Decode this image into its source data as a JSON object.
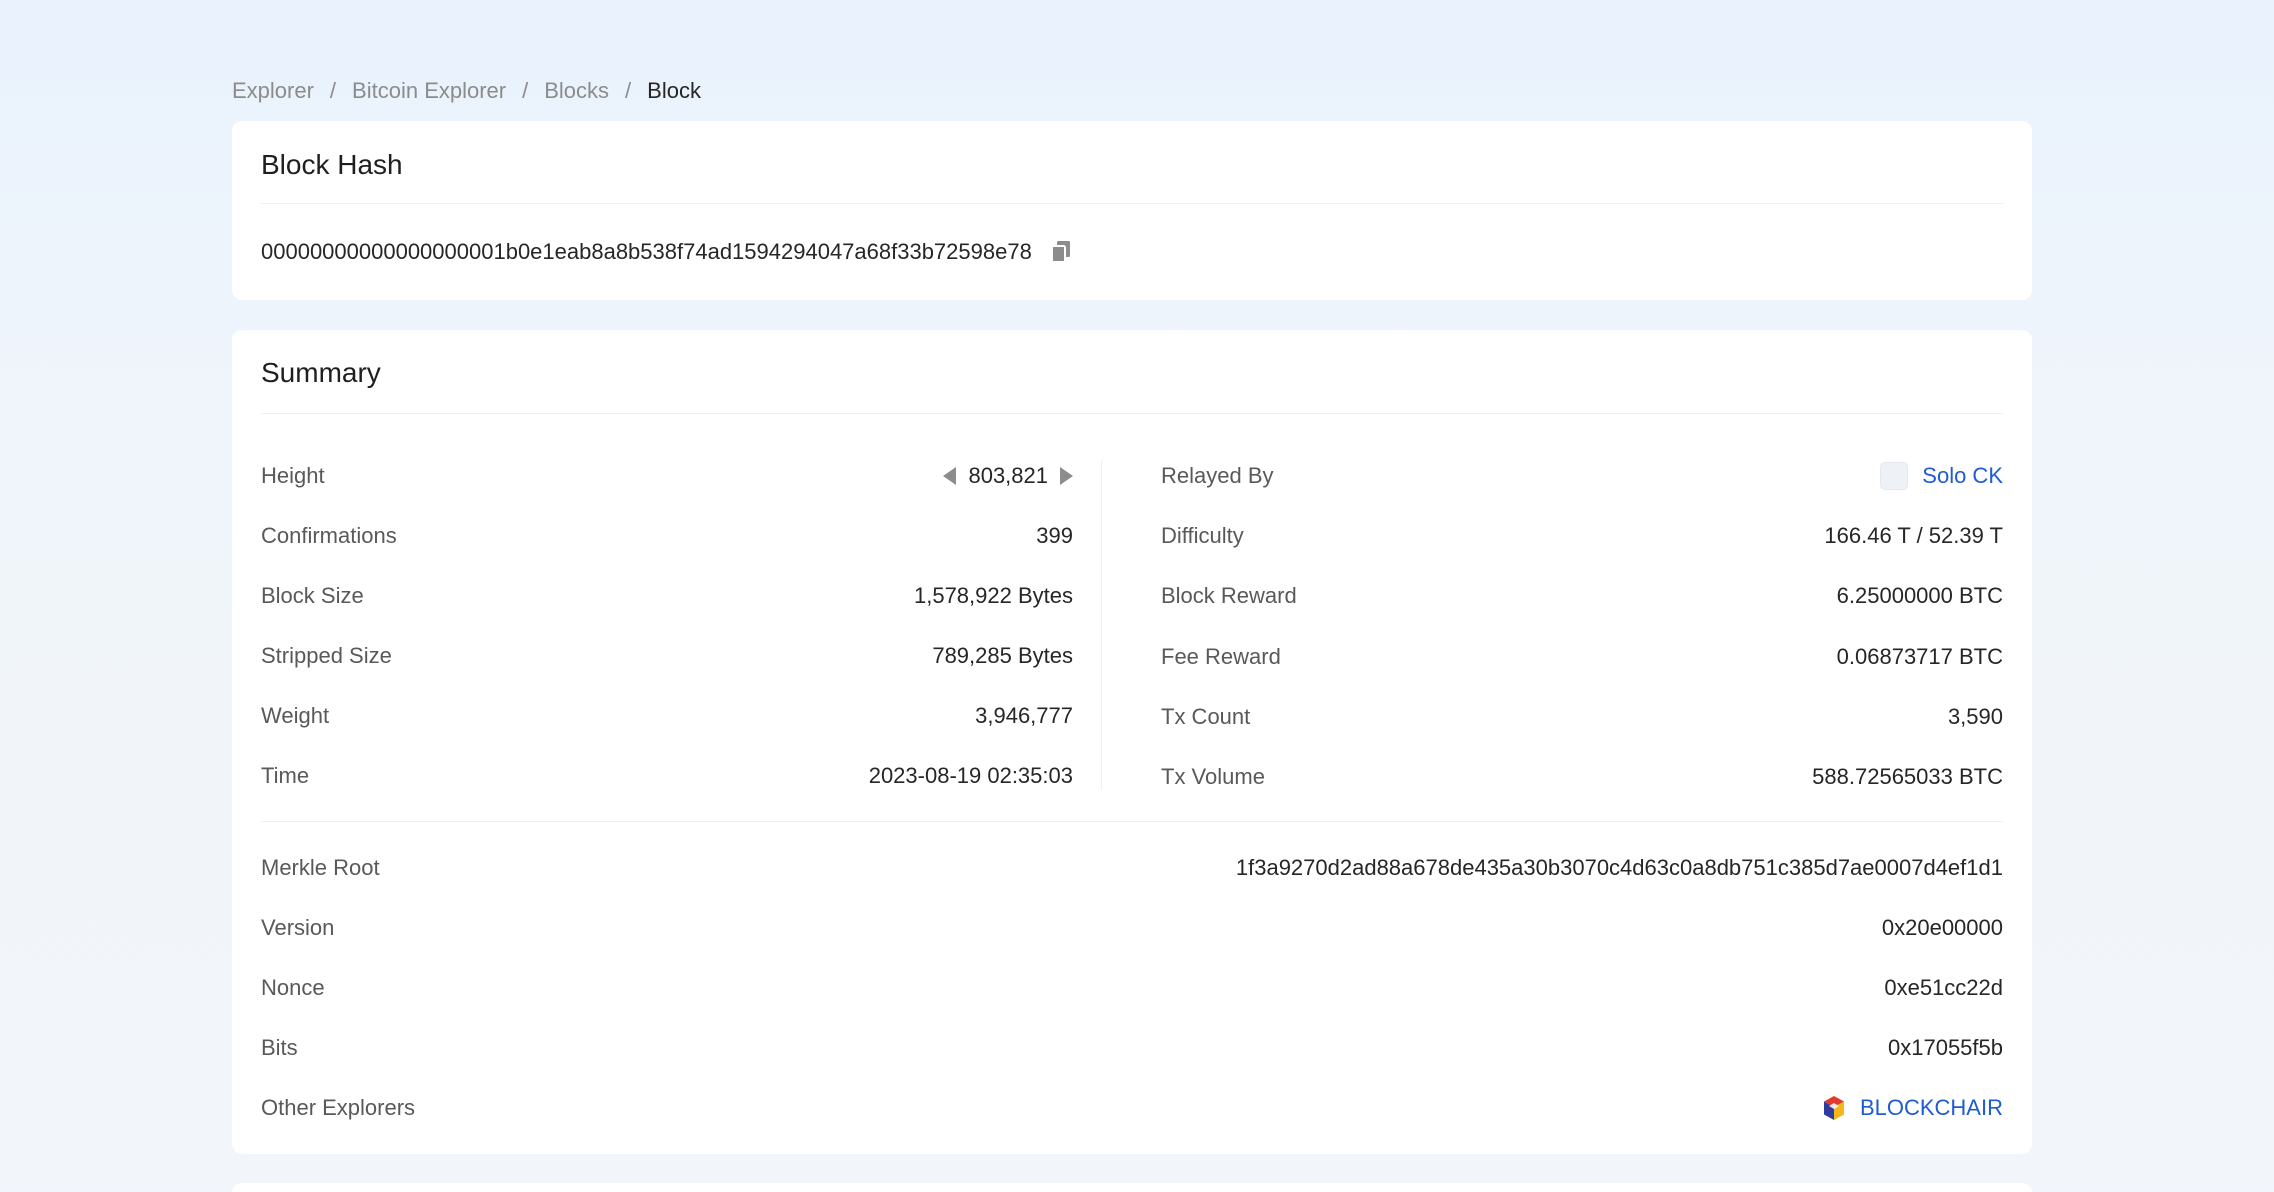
{
  "breadcrumb": {
    "items": [
      "Explorer",
      "Bitcoin Explorer",
      "Blocks"
    ],
    "separator": "/",
    "current": "Block"
  },
  "hash_card": {
    "title": "Block Hash",
    "hash": "00000000000000000001b0e1eab8a8b538f74ad1594294047a68f33b72598e78",
    "copy_icon": "copy-icon"
  },
  "summary": {
    "title": "Summary",
    "left": [
      {
        "label": "Height",
        "value": "803,821"
      },
      {
        "label": "Confirmations",
        "value": "399"
      },
      {
        "label": "Block Size",
        "value": "1,578,922 Bytes"
      },
      {
        "label": "Stripped Size",
        "value": "789,285 Bytes"
      },
      {
        "label": "Weight",
        "value": "3,946,777"
      },
      {
        "label": "Time",
        "value": "2023-08-19 02:35:03"
      }
    ],
    "right": [
      {
        "label": "Relayed By",
        "value": "Solo CK"
      },
      {
        "label": "Difficulty",
        "value": "166.46 T / 52.39 T"
      },
      {
        "label": "Block Reward",
        "value": "6.25000000 BTC"
      },
      {
        "label": "Fee Reward",
        "value": "0.06873717 BTC"
      },
      {
        "label": "Tx Count",
        "value": "3,590"
      },
      {
        "label": "Tx Volume",
        "value": "588.72565033 BTC"
      }
    ],
    "details": [
      {
        "label": "Merkle Root",
        "value": "1f3a9270d2ad88a678de435a30b3070c4d63c0a8db751c385d7ae0007d4ef1d1"
      },
      {
        "label": "Version",
        "value": "0x20e00000"
      },
      {
        "label": "Nonce",
        "value": "0xe51cc22d"
      },
      {
        "label": "Bits",
        "value": "0x17055f5b"
      },
      {
        "label": "Other Explorers",
        "value": "BLOCKCHAIR"
      }
    ]
  },
  "colors": {
    "link": "#1f5bd1",
    "label": "#595959",
    "text": "#262626",
    "arrow": "#8c8c8c"
  }
}
